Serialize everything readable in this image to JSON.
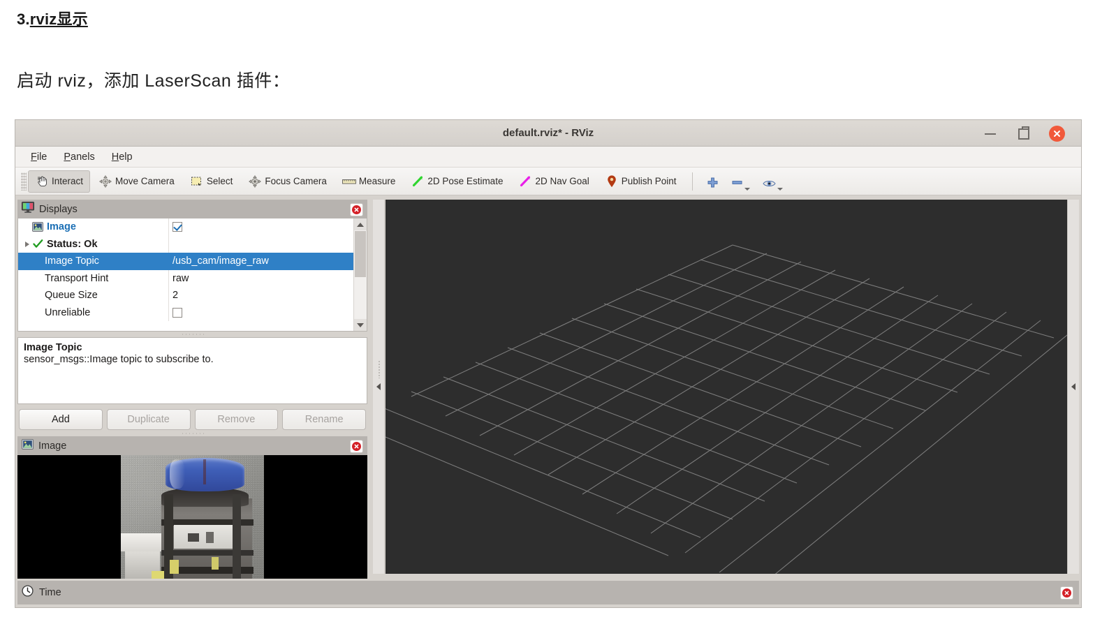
{
  "doc": {
    "heading_prefix": "3.",
    "heading_main": "rviz显示",
    "paragraph": "启动 rviz，添加 LaserScan 插件："
  },
  "window": {
    "title": "default.rviz* - RViz",
    "controls": {
      "minimize": "minimize-button",
      "maximize": "restore-button",
      "close": "close-button"
    }
  },
  "menubar": {
    "items": [
      {
        "label": "File",
        "mnemonic": "F"
      },
      {
        "label": "Panels",
        "mnemonic": "P"
      },
      {
        "label": "Help",
        "mnemonic": "H"
      }
    ]
  },
  "toolbar": {
    "tools": [
      {
        "label": "Interact",
        "icon": "hand-cursor-icon",
        "active": true
      },
      {
        "label": "Move Camera",
        "icon": "move-camera-icon",
        "active": false
      },
      {
        "label": "Select",
        "icon": "select-rect-icon",
        "active": false
      },
      {
        "label": "Focus Camera",
        "icon": "focus-camera-icon",
        "active": false
      },
      {
        "label": "Measure",
        "icon": "ruler-icon",
        "active": false
      },
      {
        "label": "2D Pose Estimate",
        "icon": "green-arrow-icon",
        "active": false
      },
      {
        "label": "2D Nav Goal",
        "icon": "magenta-arrow-icon",
        "active": false
      },
      {
        "label": "Publish Point",
        "icon": "map-pin-icon",
        "active": false
      }
    ],
    "extra": [
      {
        "icon": "plus-icon",
        "has_dropdown": false
      },
      {
        "icon": "minus-icon",
        "has_dropdown": true
      },
      {
        "icon": "eye-icon",
        "has_dropdown": true
      }
    ]
  },
  "displays_panel": {
    "title": "Displays",
    "icon": "monitor-icon",
    "rows": [
      {
        "name": "Image",
        "value": "",
        "kind": "checkbox",
        "checked": true,
        "bold": true,
        "icon": "image-display-icon",
        "selected": false,
        "expander": false
      },
      {
        "name": "Status: Ok",
        "value": "",
        "kind": "status",
        "checked": false,
        "bold": true,
        "icon": "green-check-icon",
        "selected": false,
        "expander": true
      },
      {
        "name": "Image Topic",
        "value": "/usb_cam/image_raw",
        "kind": "text",
        "checked": false,
        "bold": false,
        "icon": "",
        "selected": true,
        "expander": false
      },
      {
        "name": "Transport Hint",
        "value": "raw",
        "kind": "text",
        "checked": false,
        "bold": false,
        "icon": "",
        "selected": false,
        "expander": false
      },
      {
        "name": "Queue Size",
        "value": "2",
        "kind": "text",
        "checked": false,
        "bold": false,
        "icon": "",
        "selected": false,
        "expander": false
      },
      {
        "name": "Unreliable",
        "value": "",
        "kind": "checkbox",
        "checked": false,
        "bold": false,
        "icon": "",
        "selected": false,
        "expander": false
      }
    ]
  },
  "help": {
    "title": "Image Topic",
    "body": "sensor_msgs::Image topic to subscribe to."
  },
  "buttons": {
    "add": {
      "label": "Add",
      "disabled": false
    },
    "duplicate": {
      "label": "Duplicate",
      "disabled": true
    },
    "remove": {
      "label": "Remove",
      "disabled": true
    },
    "rename": {
      "label": "Rename",
      "disabled": true
    }
  },
  "image_panel": {
    "title": "Image",
    "icon": "image-display-icon"
  },
  "time_panel": {
    "title": "Time",
    "icon": "clock-icon"
  },
  "viewport": {
    "background_color": "#2d2d2d",
    "grid_color": "#8f8f8f",
    "left_collapse_icon": "collapse-left-arrow-icon",
    "right_collapse_icon": "collapse-right-arrow-icon"
  },
  "colors": {
    "selection_blue": "#2f80c6",
    "close_red": "#d42027",
    "title_close_orange": "#f1593a",
    "link_blue": "#1b6fb5",
    "status_green": "#2a9b2a"
  }
}
